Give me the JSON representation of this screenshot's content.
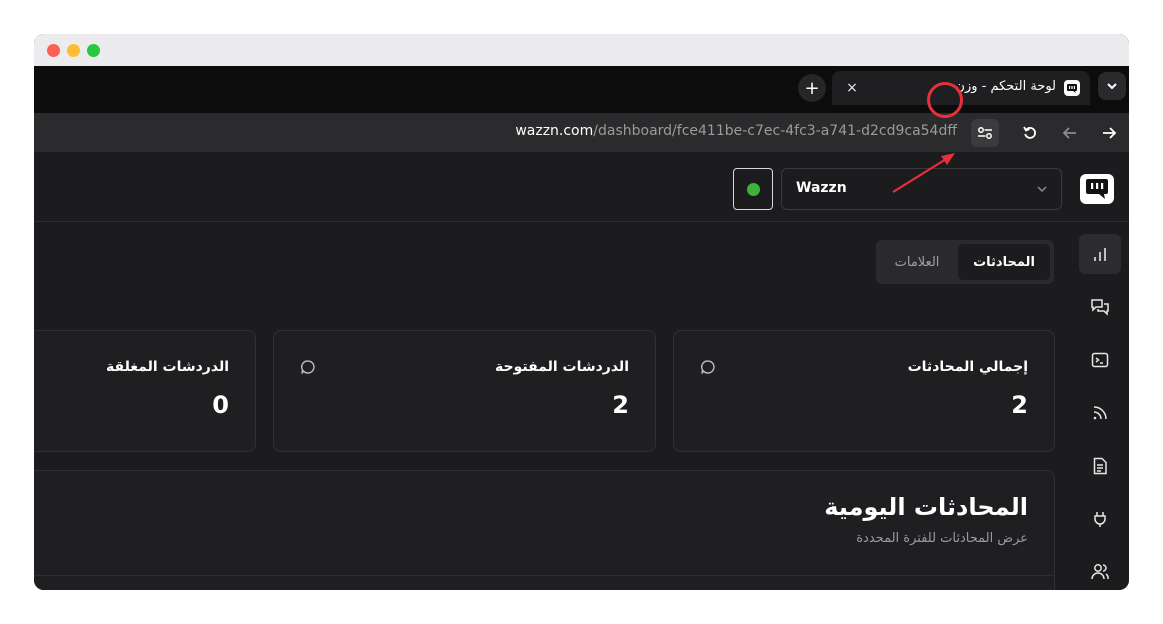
{
  "browser": {
    "tab": {
      "title": "لوحة التحكم - وزن",
      "close_label": "×"
    },
    "new_tab_label": "+",
    "address": {
      "host": "wazzn.com",
      "path": "/dashboard/fce411be-c7ec-4fc3-a741-d2cd9ca54dff"
    }
  },
  "header": {
    "workspace": "Wazzn",
    "status_color": "#3bb43b"
  },
  "view_tabs": [
    {
      "label": "المحادثات",
      "active": true
    },
    {
      "label": "العلامات",
      "active": false
    }
  ],
  "stats": [
    {
      "title": "إجمالي المحادثات",
      "value": "2",
      "icon": "message-circle-icon"
    },
    {
      "title": "الدردشات المفتوحة",
      "value": "2",
      "icon": "message-circle-icon"
    },
    {
      "title": "الدردشات المغلقة",
      "value": "0"
    }
  ],
  "daily": {
    "title": "المحادثات اليومية",
    "subtitle": "عرض المحادثات للفترة المحددة"
  },
  "sidebar_icons": [
    "bar-chart-icon",
    "messages-icon",
    "terminal-icon",
    "rss-icon",
    "document-icon",
    "plug-icon",
    "users-icon"
  ],
  "colors": {
    "accent": "#3bb43b",
    "annotation": "#e8303a"
  }
}
